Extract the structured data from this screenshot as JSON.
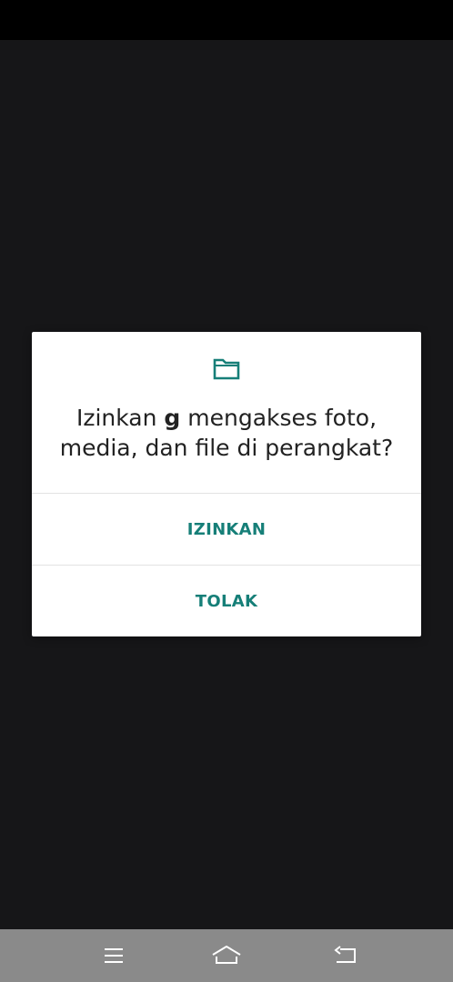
{
  "dialog": {
    "icon": "folder-icon",
    "title_prefix": "Izinkan ",
    "app_name": "g",
    "title_suffix": " mengakses foto, media, dan file di perangkat?",
    "allow_label": "IZINKAN",
    "deny_label": "TOLAK"
  },
  "nav_bar": {
    "icons": [
      "menu-icon",
      "home-icon",
      "back-icon"
    ]
  },
  "colors": {
    "accent": "#167f78",
    "background": "#161618",
    "dialog_background": "#ffffff",
    "nav_bar": "#8a8a8a"
  }
}
